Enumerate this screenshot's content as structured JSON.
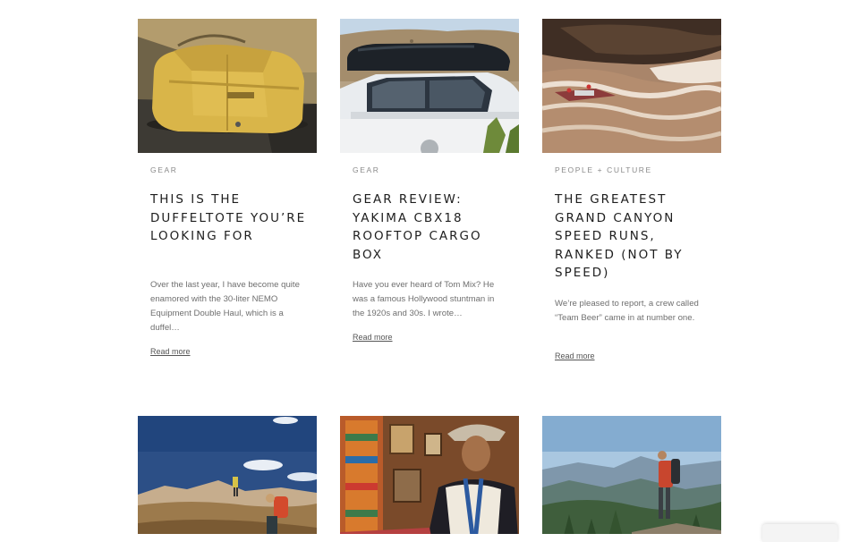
{
  "articles": [
    {
      "category": "GEAR",
      "title": "THIS IS THE DUFFELTOTE YOU’RE LOOKING FOR",
      "excerpt": "Over the last year, I have become quite enamored with the 30-liter NEMO Equipment Double Haul, which is a duffel…",
      "read_more": "Read more"
    },
    {
      "category": "GEAR",
      "title": "GEAR REVIEW: YAKIMA CBX18 ROOFTOP CARGO BOX",
      "excerpt": "Have you ever heard of Tom Mix? He was a famous Hollywood stuntman in the 1920s and 30s. I wrote…",
      "read_more": "Read more"
    },
    {
      "category": "PEOPLE + CULTURE",
      "title": "THE GREATEST GRAND CANYON SPEED RUNS, RANKED (NOT BY SPEED)",
      "excerpt": "We’re pleased to report, a crew called “Team Beer” came in at number one.",
      "read_more": "Read more"
    }
  ]
}
